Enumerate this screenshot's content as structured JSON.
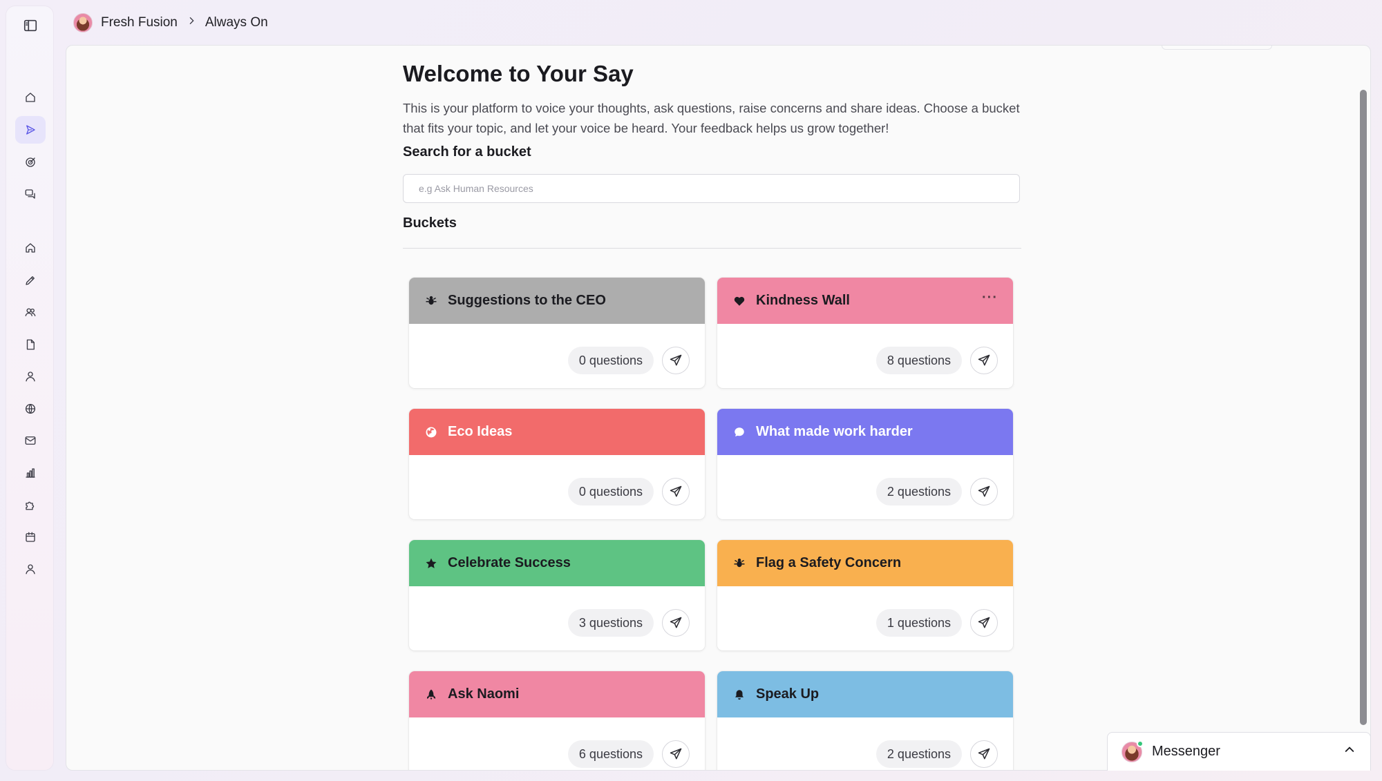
{
  "breadcrumb": {
    "org": "Fresh Fusion",
    "page": "Always On"
  },
  "sidebar": {
    "items": [
      {
        "icon": "panel-toggle-icon"
      },
      {
        "icon": "home-icon"
      },
      {
        "icon": "send-icon",
        "active": true
      },
      {
        "icon": "target-icon"
      },
      {
        "icon": "chat-icon"
      },
      {
        "icon": "home-icon"
      },
      {
        "icon": "pencil-icon"
      },
      {
        "icon": "users-icon"
      },
      {
        "icon": "document-icon"
      },
      {
        "icon": "user-icon"
      },
      {
        "icon": "globe-icon"
      },
      {
        "icon": "mail-icon"
      },
      {
        "icon": "bar-chart-icon"
      },
      {
        "icon": "puzzle-icon"
      },
      {
        "icon": "calendar-icon"
      },
      {
        "icon": "profile-icon"
      }
    ]
  },
  "main": {
    "title": "Welcome to Your Say",
    "intro": "This is your platform to voice your thoughts, ask questions, raise concerns and share ideas. Choose a bucket that fits your topic, and let your voice be heard. Your feedback helps us grow together!",
    "search_label": "Search for a bucket",
    "search_placeholder": "e.g Ask Human Resources",
    "buckets_label": "Buckets"
  },
  "buckets": [
    {
      "name": "Suggestions to the CEO",
      "count": "0 questions",
      "color": "#adadad",
      "icon": "bug-icon"
    },
    {
      "name": "Kindness Wall",
      "count": "8 questions",
      "color": "#f087a3",
      "icon": "heart-icon",
      "more": "···"
    },
    {
      "name": "Eco Ideas",
      "count": "0 questions",
      "color": "#f26b6b",
      "icon": "globe-icon",
      "light": true
    },
    {
      "name": "What made work harder",
      "count": "2 questions",
      "color": "#7b78f0",
      "icon": "chat-bubble-icon",
      "light": true
    },
    {
      "name": "Celebrate Success",
      "count": "3 questions",
      "color": "#5ec383",
      "icon": "star-icon"
    },
    {
      "name": "Flag a Safety Concern",
      "count": "1 questions",
      "color": "#f9b04f",
      "icon": "bug-icon"
    },
    {
      "name": "Ask Naomi",
      "count": "6 questions",
      "color": "#f087a3",
      "icon": "rocket-icon"
    },
    {
      "name": "Speak Up",
      "count": "2 questions",
      "color": "#7dbde3",
      "icon": "bell-icon"
    }
  ],
  "messenger": {
    "label": "Messenger"
  }
}
